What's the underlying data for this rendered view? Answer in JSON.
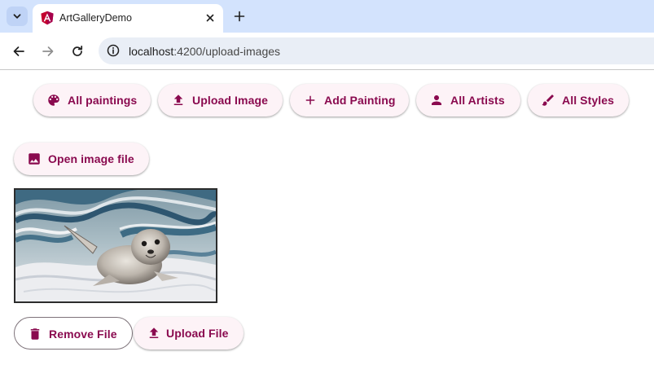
{
  "browser": {
    "tab_title": "ArtGalleryDemo",
    "url_host": "localhost",
    "url_path": ":4200/upload-images",
    "icons": [
      "tab-search-icon",
      "angular-favicon-icon",
      "close-icon",
      "plus-icon",
      "back-arrow-icon",
      "forward-arrow-icon",
      "reload-icon",
      "site-info-icon"
    ]
  },
  "nav": {
    "all_paintings": "All paintings",
    "upload_image": "Upload Image",
    "add_painting": "Add Painting",
    "all_artists": "All Artists",
    "all_styles": "All Styles"
  },
  "upload": {
    "open_file": "Open image file",
    "remove_file": "Remove File",
    "upload_file": "Upload File"
  },
  "colors": {
    "accent": "#8a0a4f",
    "button_bg": "#fdf3f7",
    "tabbar_bg": "#d3e3fd",
    "omnibox_bg": "#e9eef6"
  }
}
